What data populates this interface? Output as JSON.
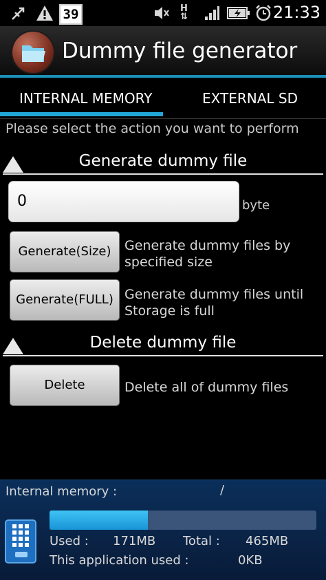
{
  "status_bar": {
    "calendar_day": "39",
    "time": "21:33",
    "network_type": "H",
    "icons": [
      "usb-debug-icon",
      "warning-icon",
      "calendar-icon",
      "mute-icon",
      "network-h-icon",
      "signal-icon",
      "battery-charging-icon",
      "alarm-icon"
    ]
  },
  "app": {
    "title": "Dummy file generator",
    "icon": "folder-icon",
    "accent_color": "#21a6d8"
  },
  "tabs": [
    {
      "label": "INTERNAL MEMORY",
      "selected": true
    },
    {
      "label": "EXTERNAL SD",
      "selected": false
    }
  ],
  "instruction": "Please select the action you want to perform",
  "generate_section": {
    "header": "Generate dummy file",
    "size_input_value": "0",
    "unit": "byte",
    "size_button": "Generate(Size)",
    "size_desc": "Generate dummy files by specified size",
    "full_button": "Generate(FULL)",
    "full_desc": "Generate dummy files until Storage is full"
  },
  "delete_section": {
    "header": "Delete dummy file",
    "delete_button": "Delete",
    "delete_desc": "Delete all of dummy files"
  },
  "memory_panel": {
    "label": "Internal memory :",
    "separator": "/",
    "used_label": "Used :",
    "used_value": "171MB",
    "total_label": "Total :",
    "total_value": "465MB",
    "app_used_label": "This application used :",
    "app_used_value": "0KB",
    "used_fraction": 0.368
  }
}
